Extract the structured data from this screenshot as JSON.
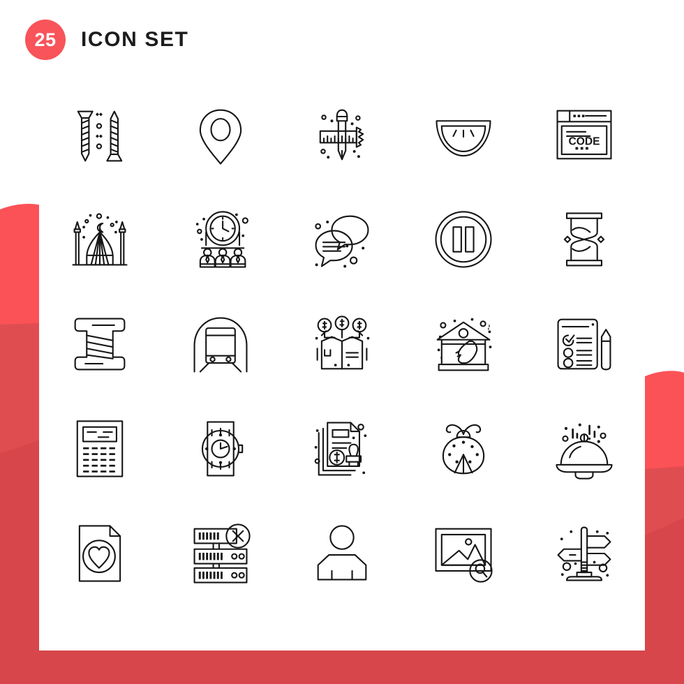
{
  "header": {
    "count": "25",
    "title": "ICON SET"
  },
  "colors": {
    "brand_red": "#f8545a",
    "deep_red": "#d6464a",
    "mid_red": "#df4c50",
    "card_white": "#ffffff",
    "stroke_dark": "#161616"
  },
  "labels": {
    "code_screen": "CODE"
  },
  "grid": {
    "columns": 5,
    "rows": 5,
    "total": 25
  },
  "icons": [
    {
      "row": 1,
      "col": 1,
      "name": "screws-nails-icon",
      "label": "Screws"
    },
    {
      "row": 1,
      "col": 2,
      "name": "location-pin-icon",
      "label": "Location Pin"
    },
    {
      "row": 1,
      "col": 3,
      "name": "drawing-tools-icon",
      "label": "Pencil And Ruler"
    },
    {
      "row": 1,
      "col": 4,
      "name": "watermelon-slice-icon",
      "label": "Watermelon"
    },
    {
      "row": 1,
      "col": 5,
      "name": "code-browser-icon",
      "label": "Code Window"
    },
    {
      "row": 2,
      "col": 1,
      "name": "mosque-icon",
      "label": "Mosque"
    },
    {
      "row": 2,
      "col": 2,
      "name": "team-meeting-time-icon",
      "label": "Meeting Time"
    },
    {
      "row": 2,
      "col": 3,
      "name": "chat-bubbles-icon",
      "label": "Chat"
    },
    {
      "row": 2,
      "col": 4,
      "name": "pause-button-icon",
      "label": "Pause"
    },
    {
      "row": 2,
      "col": 5,
      "name": "hourglass-icon",
      "label": "Hourglass"
    },
    {
      "row": 3,
      "col": 1,
      "name": "thread-spool-icon",
      "label": "Thread Spool"
    },
    {
      "row": 3,
      "col": 2,
      "name": "subway-train-icon",
      "label": "Subway"
    },
    {
      "row": 3,
      "col": 3,
      "name": "crowdfunding-box-icon",
      "label": "Crowdfunding"
    },
    {
      "row": 3,
      "col": 4,
      "name": "museum-sculpture-icon",
      "label": "Museum"
    },
    {
      "row": 3,
      "col": 5,
      "name": "checklist-pencil-icon",
      "label": "Survey"
    },
    {
      "row": 4,
      "col": 1,
      "name": "calculator-icon",
      "label": "Calculator"
    },
    {
      "row": 4,
      "col": 2,
      "name": "wristwatch-icon",
      "label": "Wristwatch"
    },
    {
      "row": 4,
      "col": 3,
      "name": "invoice-stamp-icon",
      "label": "Stamped Invoice"
    },
    {
      "row": 4,
      "col": 4,
      "name": "ladybug-icon",
      "label": "Ladybug"
    },
    {
      "row": 4,
      "col": 5,
      "name": "food-cloche-icon",
      "label": "Serving Dome"
    },
    {
      "row": 5,
      "col": 1,
      "name": "favorite-file-icon",
      "label": "File With Heart"
    },
    {
      "row": 5,
      "col": 2,
      "name": "server-delete-icon",
      "label": "Server Error"
    },
    {
      "row": 5,
      "col": 3,
      "name": "user-avatar-icon",
      "label": "User"
    },
    {
      "row": 5,
      "col": 4,
      "name": "image-search-icon",
      "label": "Search Image"
    },
    {
      "row": 5,
      "col": 5,
      "name": "signpost-icon",
      "label": "Signpost"
    }
  ]
}
